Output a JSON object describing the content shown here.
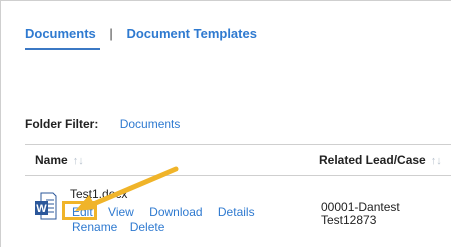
{
  "tabs": {
    "active": "Documents",
    "separator": "|",
    "other": "Document Templates"
  },
  "folder_filter": {
    "label": "Folder Filter:",
    "value": "Documents"
  },
  "table": {
    "columns": [
      {
        "label": "Name",
        "sort_icon": "↑↓"
      },
      {
        "label": "Related Lead/Case",
        "sort_icon": "↑↓"
      }
    ],
    "rows": [
      {
        "icon": "word-doc-icon",
        "file_name": "Test1.docx",
        "actions_line1": [
          "Edit",
          "View",
          "Download",
          "Details"
        ],
        "actions_line2": [
          "Rename",
          "Delete"
        ],
        "related_line1": "00001-Dantest",
        "related_line2": "Test12873"
      }
    ]
  },
  "colors": {
    "link": "#2f7ad0",
    "highlight": "#f0b429",
    "word_icon": "#2b579a"
  }
}
